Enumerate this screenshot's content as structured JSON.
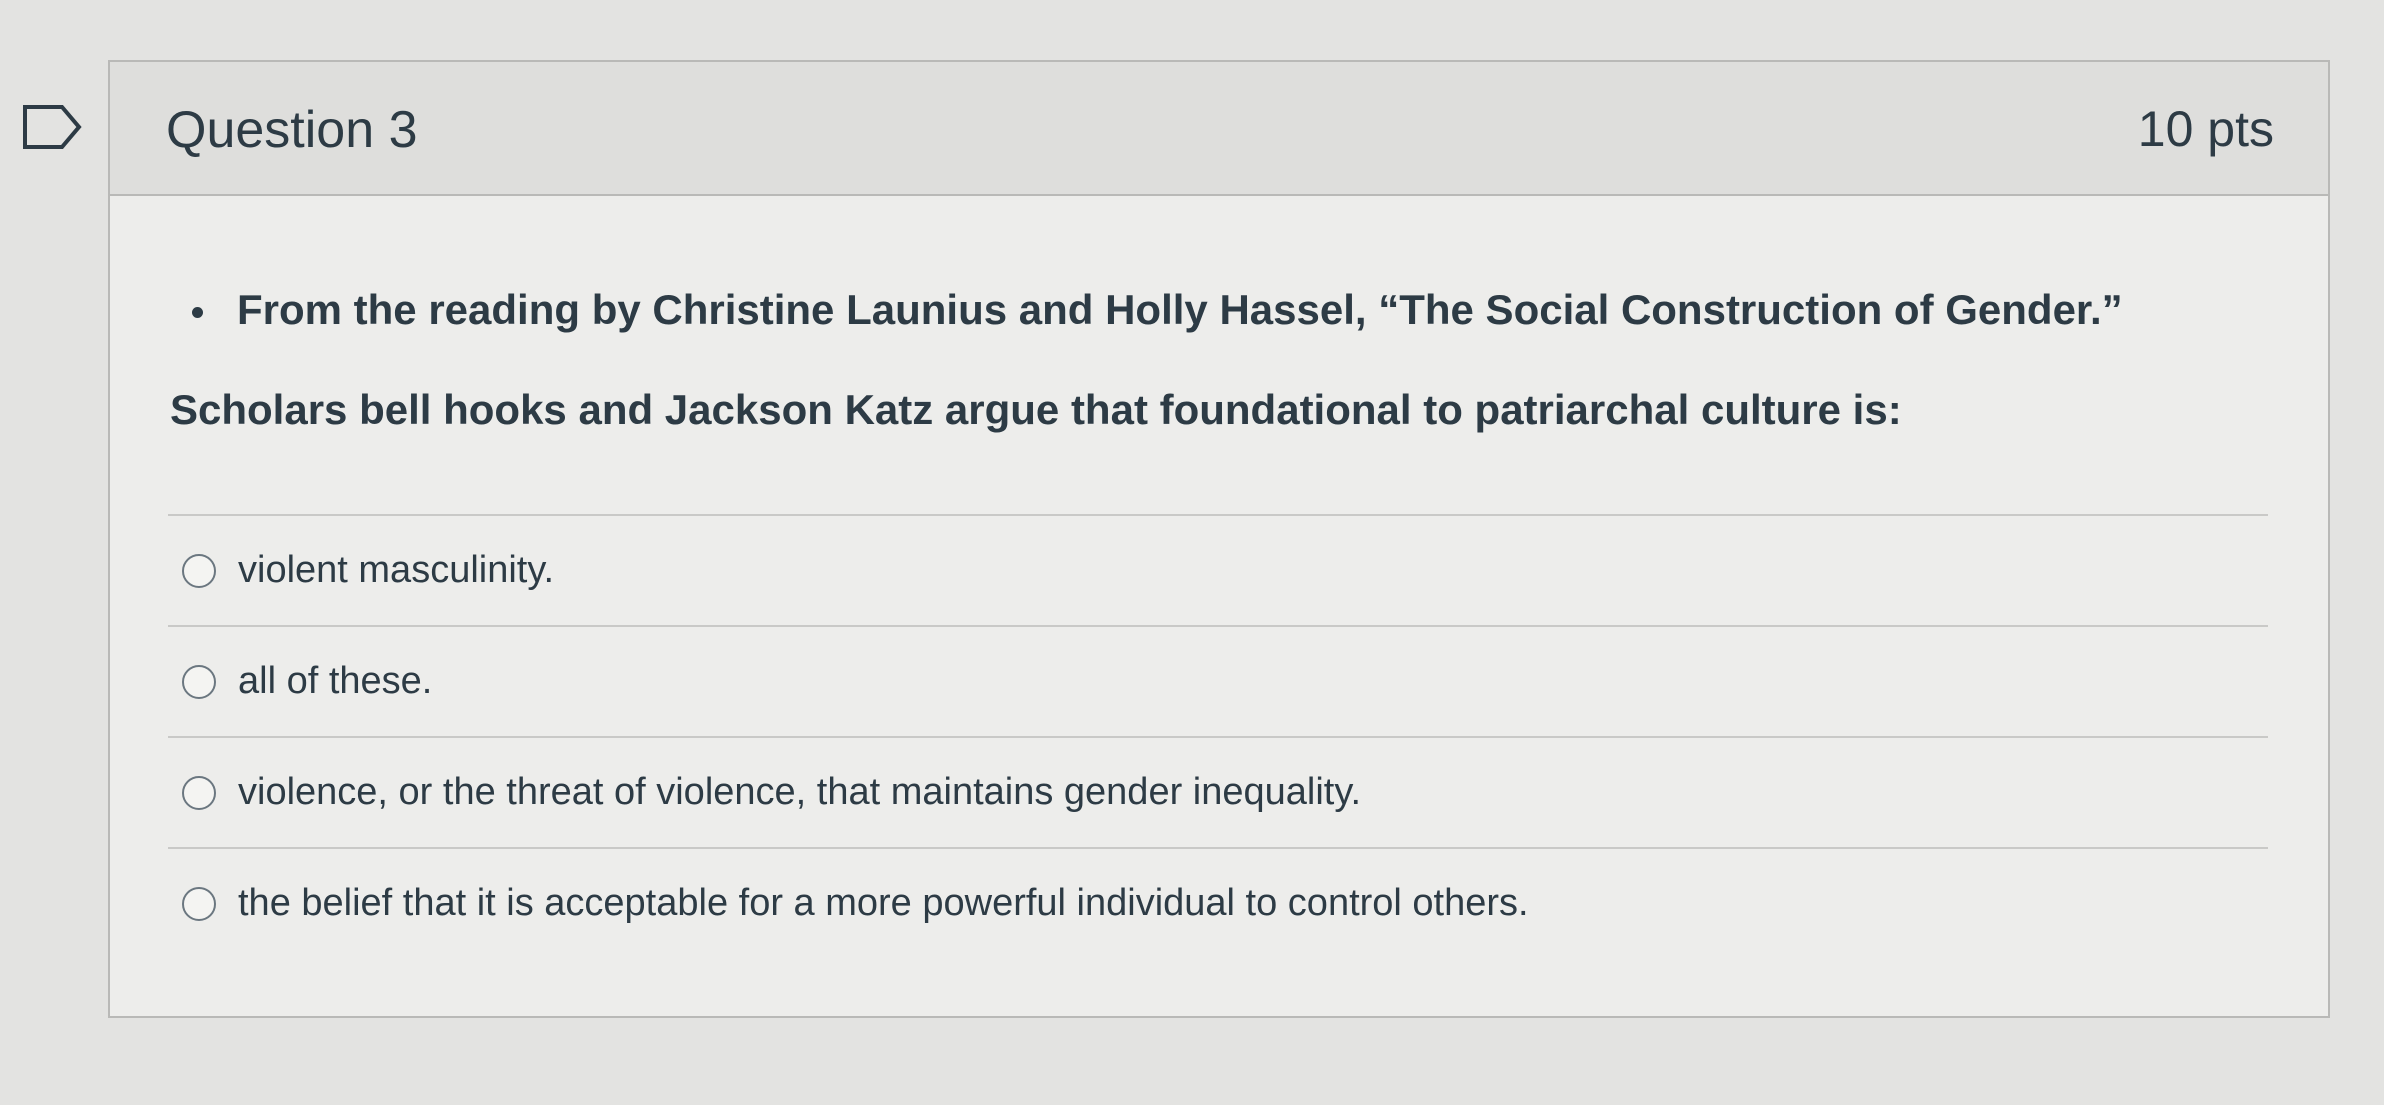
{
  "question": {
    "title": "Question 3",
    "points": "10 pts",
    "bullet_text": "From the reading by Christine Launius and Holly Hassel, “The Social Construction of Gender.”",
    "prompt": "Scholars bell hooks and Jackson Katz argue that foundational to patriarchal culture is:",
    "answers": [
      {
        "label": "violent masculinity."
      },
      {
        "label": "all of these."
      },
      {
        "label": "violence, or the threat of violence, that maintains gender inequality."
      },
      {
        "label": "the belief that it is acceptable for a more powerful individual to control others."
      }
    ]
  },
  "icons": {
    "flag": "flag-question-icon",
    "radio": "radio-unselected-icon",
    "bullet": "bullet-icon"
  },
  "colors": {
    "text": "#2d3b45",
    "header_bg": "#dededc",
    "body_bg": "#ededeb",
    "border": "#b9b9b7"
  }
}
